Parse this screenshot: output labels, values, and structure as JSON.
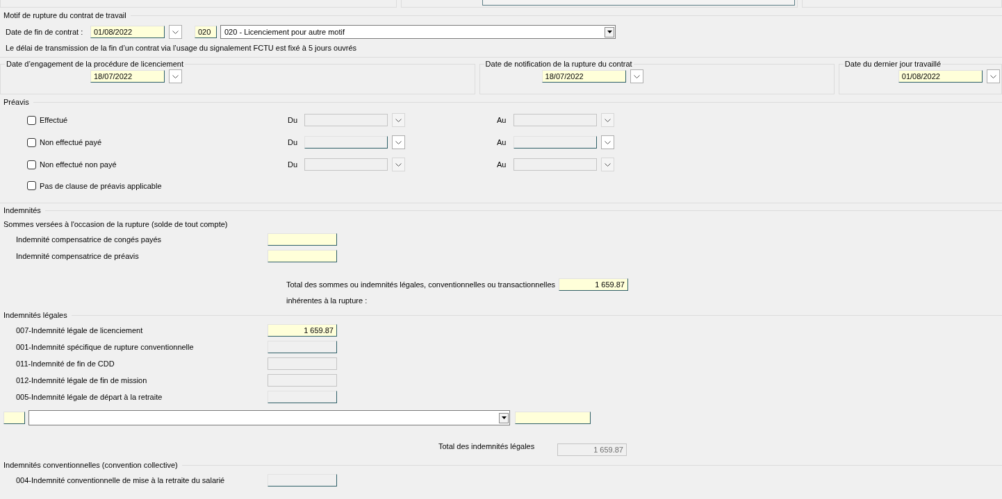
{
  "motif": {
    "title": "Motif de rupture du contrat de travail",
    "end_date": {
      "label": "Date de fin de contrat :",
      "value": "01/08/2022"
    },
    "reason": {
      "code": "020",
      "value": "020 - Licenciement pour autre motif"
    },
    "note": "Le délai de transmission de la fin d’un contrat via l’usage du signalement FCTU est fixé à 5 jours ouvrés"
  },
  "dates": [
    {
      "title": "Date d’engagement de la procédure de licenciement",
      "value": "18/07/2022"
    },
    {
      "title": "Date de notification de la rupture du contrat",
      "value": "18/07/2022"
    },
    {
      "title": "Date du dernier jour travaillé",
      "value": "01/08/2022"
    }
  ],
  "preavis": {
    "title": "Préavis",
    "options": [
      {
        "label": "Effectué",
        "checked": false,
        "kind": "range",
        "disabled": true,
        "from_label": "Du",
        "to_label": "Au"
      },
      {
        "label": "Non effectué payé",
        "checked": false,
        "kind": "range",
        "disabled": false,
        "from_label": "Du",
        "to_label": "Au"
      },
      {
        "label": "Non effectué non payé",
        "checked": false,
        "kind": "range",
        "disabled": true,
        "from_label": "Du",
        "to_label": "Au"
      },
      {
        "label": "Pas de clause de préavis applicable",
        "checked": false,
        "kind": "plain"
      }
    ]
  },
  "indemnites": {
    "title": "Indemnités",
    "subtitle": "Sommes versées à l'occasion de la rupture (solde de tout compte)",
    "items": [
      {
        "label": "Indemnité compensatrice de congés payés"
      },
      {
        "label": "Indemnité compensatrice de préavis"
      }
    ],
    "total": {
      "label": "Total des sommes ou indemnités légales, conventionnelles ou transactionnelles",
      "label_2": "inhérentes à la rupture :",
      "value": "1 659.87"
    }
  },
  "legales": {
    "title": "Indemnités légales",
    "items": [
      {
        "label": "007-Indemnité légale de licenciement",
        "value": "1 659.87",
        "kind": "required"
      },
      {
        "label": "001-Indemnité spécifique de rupture conventionnelle",
        "kind": "editable"
      },
      {
        "label": "011-Indemnité de fin de CDD",
        "kind": "disabled"
      },
      {
        "label": "012-Indemnité légale de fin de mission",
        "kind": "disabled"
      },
      {
        "label": "005-Indemnité légale de départ à la retraite",
        "kind": "editable"
      }
    ],
    "total": {
      "label": "Total des indemnités légales",
      "value": "1 659.87",
      "disabled": true
    }
  },
  "conventionnelles": {
    "title": "Indemnités conventionnelles (convention collective)",
    "items": [
      {
        "label": "004-Indemnité conventionnelle de mise à la retraite du salarié",
        "kind": "editable"
      }
    ]
  }
}
